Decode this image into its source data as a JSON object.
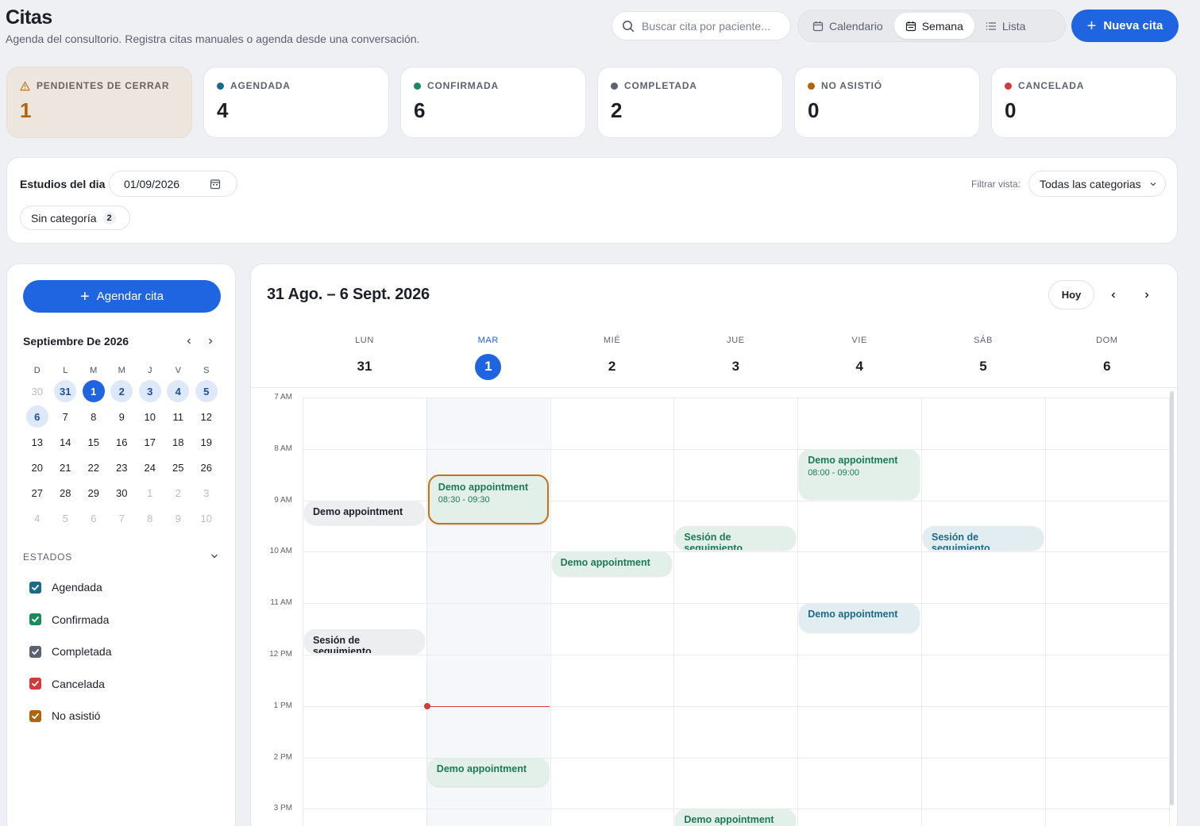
{
  "header": {
    "title": "Citas",
    "subtitle": "Agenda del consultorio. Registra citas manuales o agenda desde una conversación.",
    "search_placeholder": "Buscar cita por paciente...",
    "views": [
      {
        "label": "Calendario",
        "icon": "calendar-icon"
      },
      {
        "label": "Semana",
        "icon": "calendar-week-icon"
      },
      {
        "label": "Lista",
        "icon": "list-icon"
      }
    ],
    "active_view": "Semana",
    "new_button": "Nueva cita"
  },
  "stats": [
    {
      "label": "PENDIENTES DE CERRAR",
      "value": "1",
      "color": "#c2741a",
      "icon": "warning-icon"
    },
    {
      "label": "AGENDADA",
      "value": "4",
      "color": "#1c6a8a"
    },
    {
      "label": "CONFIRMADA",
      "value": "6",
      "color": "#1d8a5e"
    },
    {
      "label": "COMPLETADA",
      "value": "2",
      "color": "#5b6270"
    },
    {
      "label": "NO ASISTIÓ",
      "value": "0",
      "color": "#b0650c"
    },
    {
      "label": "CANCELADA",
      "value": "0",
      "color": "#d23b3b"
    }
  ],
  "estudios": {
    "label": "Estudios del dia",
    "date": "01/09/2026",
    "filter_label": "Filtrar vista:",
    "filter_value": "Todas las categorias",
    "chip": {
      "label": "Sin categoría",
      "count": "2"
    }
  },
  "sidebar": {
    "agendar_button": "Agendar cita",
    "month_title": "Septiembre De 2026",
    "weekdays": [
      "D",
      "L",
      "M",
      "M",
      "J",
      "V",
      "S"
    ],
    "weeks": [
      [
        {
          "d": "30",
          "s": "muted"
        },
        {
          "d": "31",
          "s": "wk"
        },
        {
          "d": "1",
          "s": "today"
        },
        {
          "d": "2",
          "s": "wk"
        },
        {
          "d": "3",
          "s": "wk"
        },
        {
          "d": "4",
          "s": "wk"
        },
        {
          "d": "5",
          "s": "wk"
        }
      ],
      [
        {
          "d": "6",
          "s": "wk"
        },
        {
          "d": "7",
          "s": ""
        },
        {
          "d": "8",
          "s": ""
        },
        {
          "d": "9",
          "s": ""
        },
        {
          "d": "10",
          "s": ""
        },
        {
          "d": "11",
          "s": ""
        },
        {
          "d": "12",
          "s": ""
        }
      ],
      [
        {
          "d": "13",
          "s": ""
        },
        {
          "d": "14",
          "s": ""
        },
        {
          "d": "15",
          "s": ""
        },
        {
          "d": "16",
          "s": ""
        },
        {
          "d": "17",
          "s": ""
        },
        {
          "d": "18",
          "s": ""
        },
        {
          "d": "19",
          "s": ""
        }
      ],
      [
        {
          "d": "20",
          "s": ""
        },
        {
          "d": "21",
          "s": ""
        },
        {
          "d": "22",
          "s": ""
        },
        {
          "d": "23",
          "s": ""
        },
        {
          "d": "24",
          "s": ""
        },
        {
          "d": "25",
          "s": ""
        },
        {
          "d": "26",
          "s": ""
        }
      ],
      [
        {
          "d": "27",
          "s": ""
        },
        {
          "d": "28",
          "s": ""
        },
        {
          "d": "29",
          "s": ""
        },
        {
          "d": "30",
          "s": ""
        },
        {
          "d": "1",
          "s": "muted"
        },
        {
          "d": "2",
          "s": "muted"
        },
        {
          "d": "3",
          "s": "muted"
        }
      ],
      [
        {
          "d": "4",
          "s": "muted"
        },
        {
          "d": "5",
          "s": "muted"
        },
        {
          "d": "6",
          "s": "muted"
        },
        {
          "d": "7",
          "s": "muted"
        },
        {
          "d": "8",
          "s": "muted"
        },
        {
          "d": "9",
          "s": "muted"
        },
        {
          "d": "10",
          "s": "muted"
        }
      ]
    ],
    "estados_title": "ESTADOS",
    "estados": [
      {
        "label": "Agendada",
        "color": "#1c6a8a"
      },
      {
        "label": "Confirmada",
        "color": "#1d8a5e"
      },
      {
        "label": "Completada",
        "color": "#5b6270"
      },
      {
        "label": "Cancelada",
        "color": "#d23b3b"
      },
      {
        "label": "No asistió",
        "color": "#b0650c"
      }
    ]
  },
  "calendar": {
    "range": "31 Ago. – 6 Sept. 2026",
    "today_button": "Hoy",
    "days": [
      {
        "name": "LUN",
        "num": "31"
      },
      {
        "name": "MAR",
        "num": "1"
      },
      {
        "name": "MIÉ",
        "num": "2"
      },
      {
        "name": "JUE",
        "num": "3"
      },
      {
        "name": "VIE",
        "num": "4"
      },
      {
        "name": "SÁB",
        "num": "5"
      },
      {
        "name": "DOM",
        "num": "6"
      }
    ],
    "active_day": 1,
    "hours": [
      "7 AM",
      "8 AM",
      "9 AM",
      "10 AM",
      "11 AM",
      "12 PM",
      "1 PM",
      "2 PM",
      "3 PM"
    ],
    "now_hour": 13,
    "events": [
      {
        "title": "Demo appointment",
        "day": 0,
        "start": 9.0,
        "end": 9.5,
        "style": "gray"
      },
      {
        "title": "Demo appointment",
        "time": "08:30 - 09:30",
        "day": 1,
        "start": 8.5,
        "end": 9.5,
        "style": "green",
        "pending": true
      },
      {
        "title": "Demo appointment",
        "time": "08:00 - 09:00",
        "day": 4,
        "start": 8.0,
        "end": 9.0,
        "style": "green"
      },
      {
        "title": "Sesión de seguimiento",
        "day": 3,
        "start": 9.5,
        "end": 10.0,
        "style": "green"
      },
      {
        "title": "Sesión de seguimiento",
        "day": 5,
        "start": 9.5,
        "end": 10.0,
        "style": "blue"
      },
      {
        "title": "Demo appointment",
        "day": 2,
        "start": 10.0,
        "end": 10.5,
        "style": "green"
      },
      {
        "title": "Demo appointment",
        "day": 4,
        "start": 11.0,
        "end": 11.6,
        "style": "blue"
      },
      {
        "title": "Sesión de seguimiento",
        "day": 0,
        "start": 11.5,
        "end": 12.0,
        "style": "gray"
      },
      {
        "title": "Demo appointment",
        "day": 1,
        "start": 14.0,
        "end": 14.6,
        "style": "green"
      },
      {
        "title": "Demo appointment",
        "day": 3,
        "start": 15.0,
        "end": 15.5,
        "style": "green"
      }
    ]
  }
}
